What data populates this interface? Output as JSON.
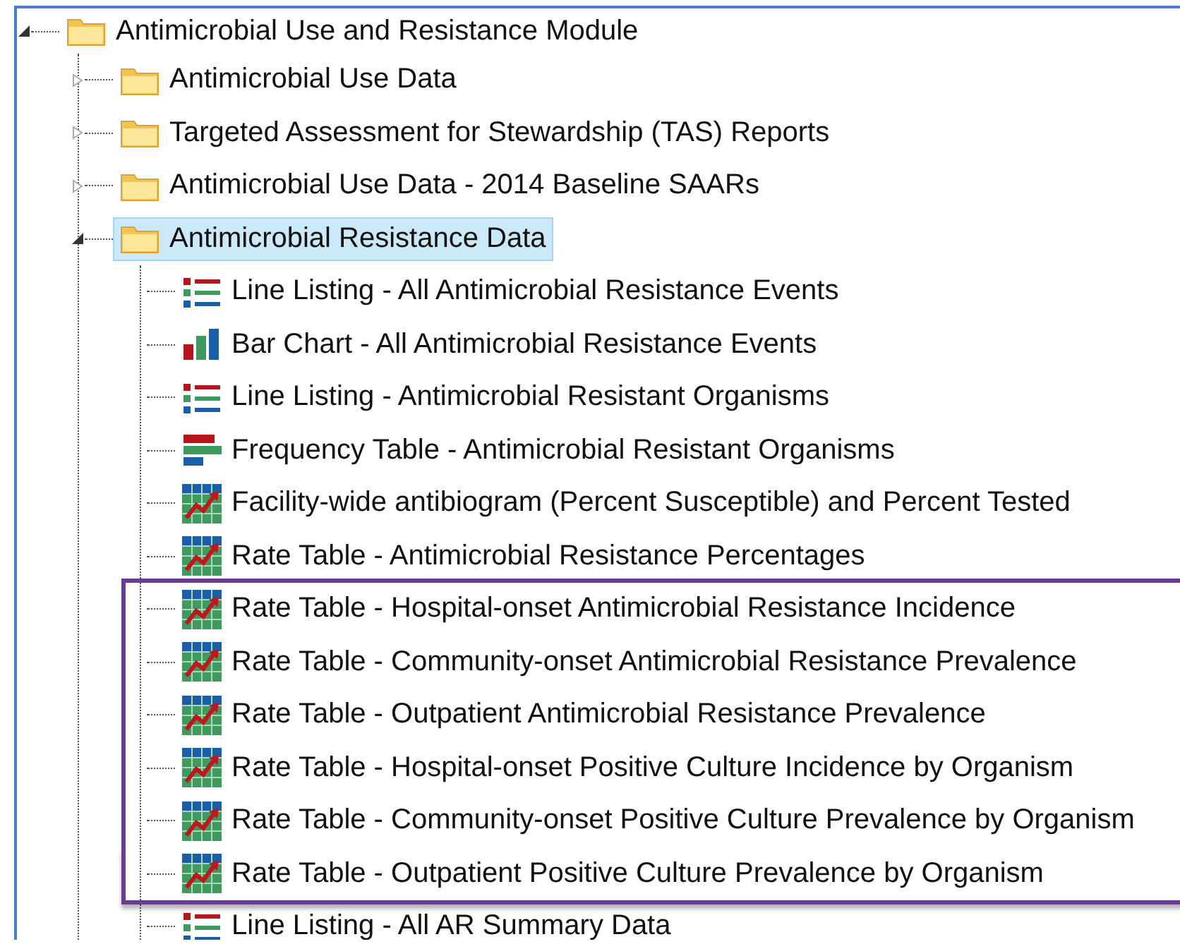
{
  "tree": [
    {
      "label": "Antimicrobial Use and Resistance Module",
      "kind": "folder",
      "expanded": true,
      "selected": false,
      "children": [
        {
          "label": "Antimicrobial Use Data",
          "kind": "folder",
          "expanded": false,
          "selected": false
        },
        {
          "label": "Targeted Assessment for Stewardship (TAS) Reports",
          "kind": "folder",
          "expanded": false,
          "selected": false
        },
        {
          "label": "Antimicrobial Use Data - 2014 Baseline SAARs",
          "kind": "folder",
          "expanded": false,
          "selected": false
        },
        {
          "label": "Antimicrobial Resistance Data",
          "kind": "folder",
          "expanded": true,
          "selected": true,
          "children": [
            {
              "label": "Line Listing - All Antimicrobial Resistance Events",
              "kind": "listing",
              "selected": false,
              "highlighted": false
            },
            {
              "label": "Bar Chart - All Antimicrobial Resistance Events",
              "kind": "bar",
              "selected": false,
              "highlighted": false
            },
            {
              "label": "Line Listing - Antimicrobial Resistant Organisms",
              "kind": "listing",
              "selected": false,
              "highlighted": false
            },
            {
              "label": "Frequency Table - Antimicrobial Resistant Organisms",
              "kind": "frequency",
              "selected": false,
              "highlighted": false
            },
            {
              "label": "Facility-wide antibiogram (Percent Susceptible) and Percent Tested",
              "kind": "rate",
              "selected": false,
              "highlighted": false
            },
            {
              "label": "Rate Table - Antimicrobial Resistance Percentages",
              "kind": "rate",
              "selected": false,
              "highlighted": false
            },
            {
              "label": "Rate Table - Hospital-onset Antimicrobial Resistance Incidence",
              "kind": "rate",
              "selected": false,
              "highlighted": true
            },
            {
              "label": "Rate Table - Community-onset Antimicrobial Resistance Prevalence",
              "kind": "rate",
              "selected": false,
              "highlighted": true
            },
            {
              "label": "Rate Table - Outpatient Antimicrobial Resistance Prevalence",
              "kind": "rate",
              "selected": false,
              "highlighted": true
            },
            {
              "label": "Rate Table - Hospital-onset Positive Culture Incidence by Organism",
              "kind": "rate",
              "selected": false,
              "highlighted": true
            },
            {
              "label": "Rate Table - Community-onset Positive Culture Prevalence by Organism",
              "kind": "rate",
              "selected": false,
              "highlighted": true
            },
            {
              "label": "Rate Table - Outpatient Positive Culture Prevalence by Organism",
              "kind": "rate",
              "selected": false,
              "highlighted": true
            },
            {
              "label": "Line Listing - All AR Summary Data",
              "kind": "listing",
              "selected": false,
              "highlighted": false
            }
          ]
        }
      ]
    }
  ]
}
